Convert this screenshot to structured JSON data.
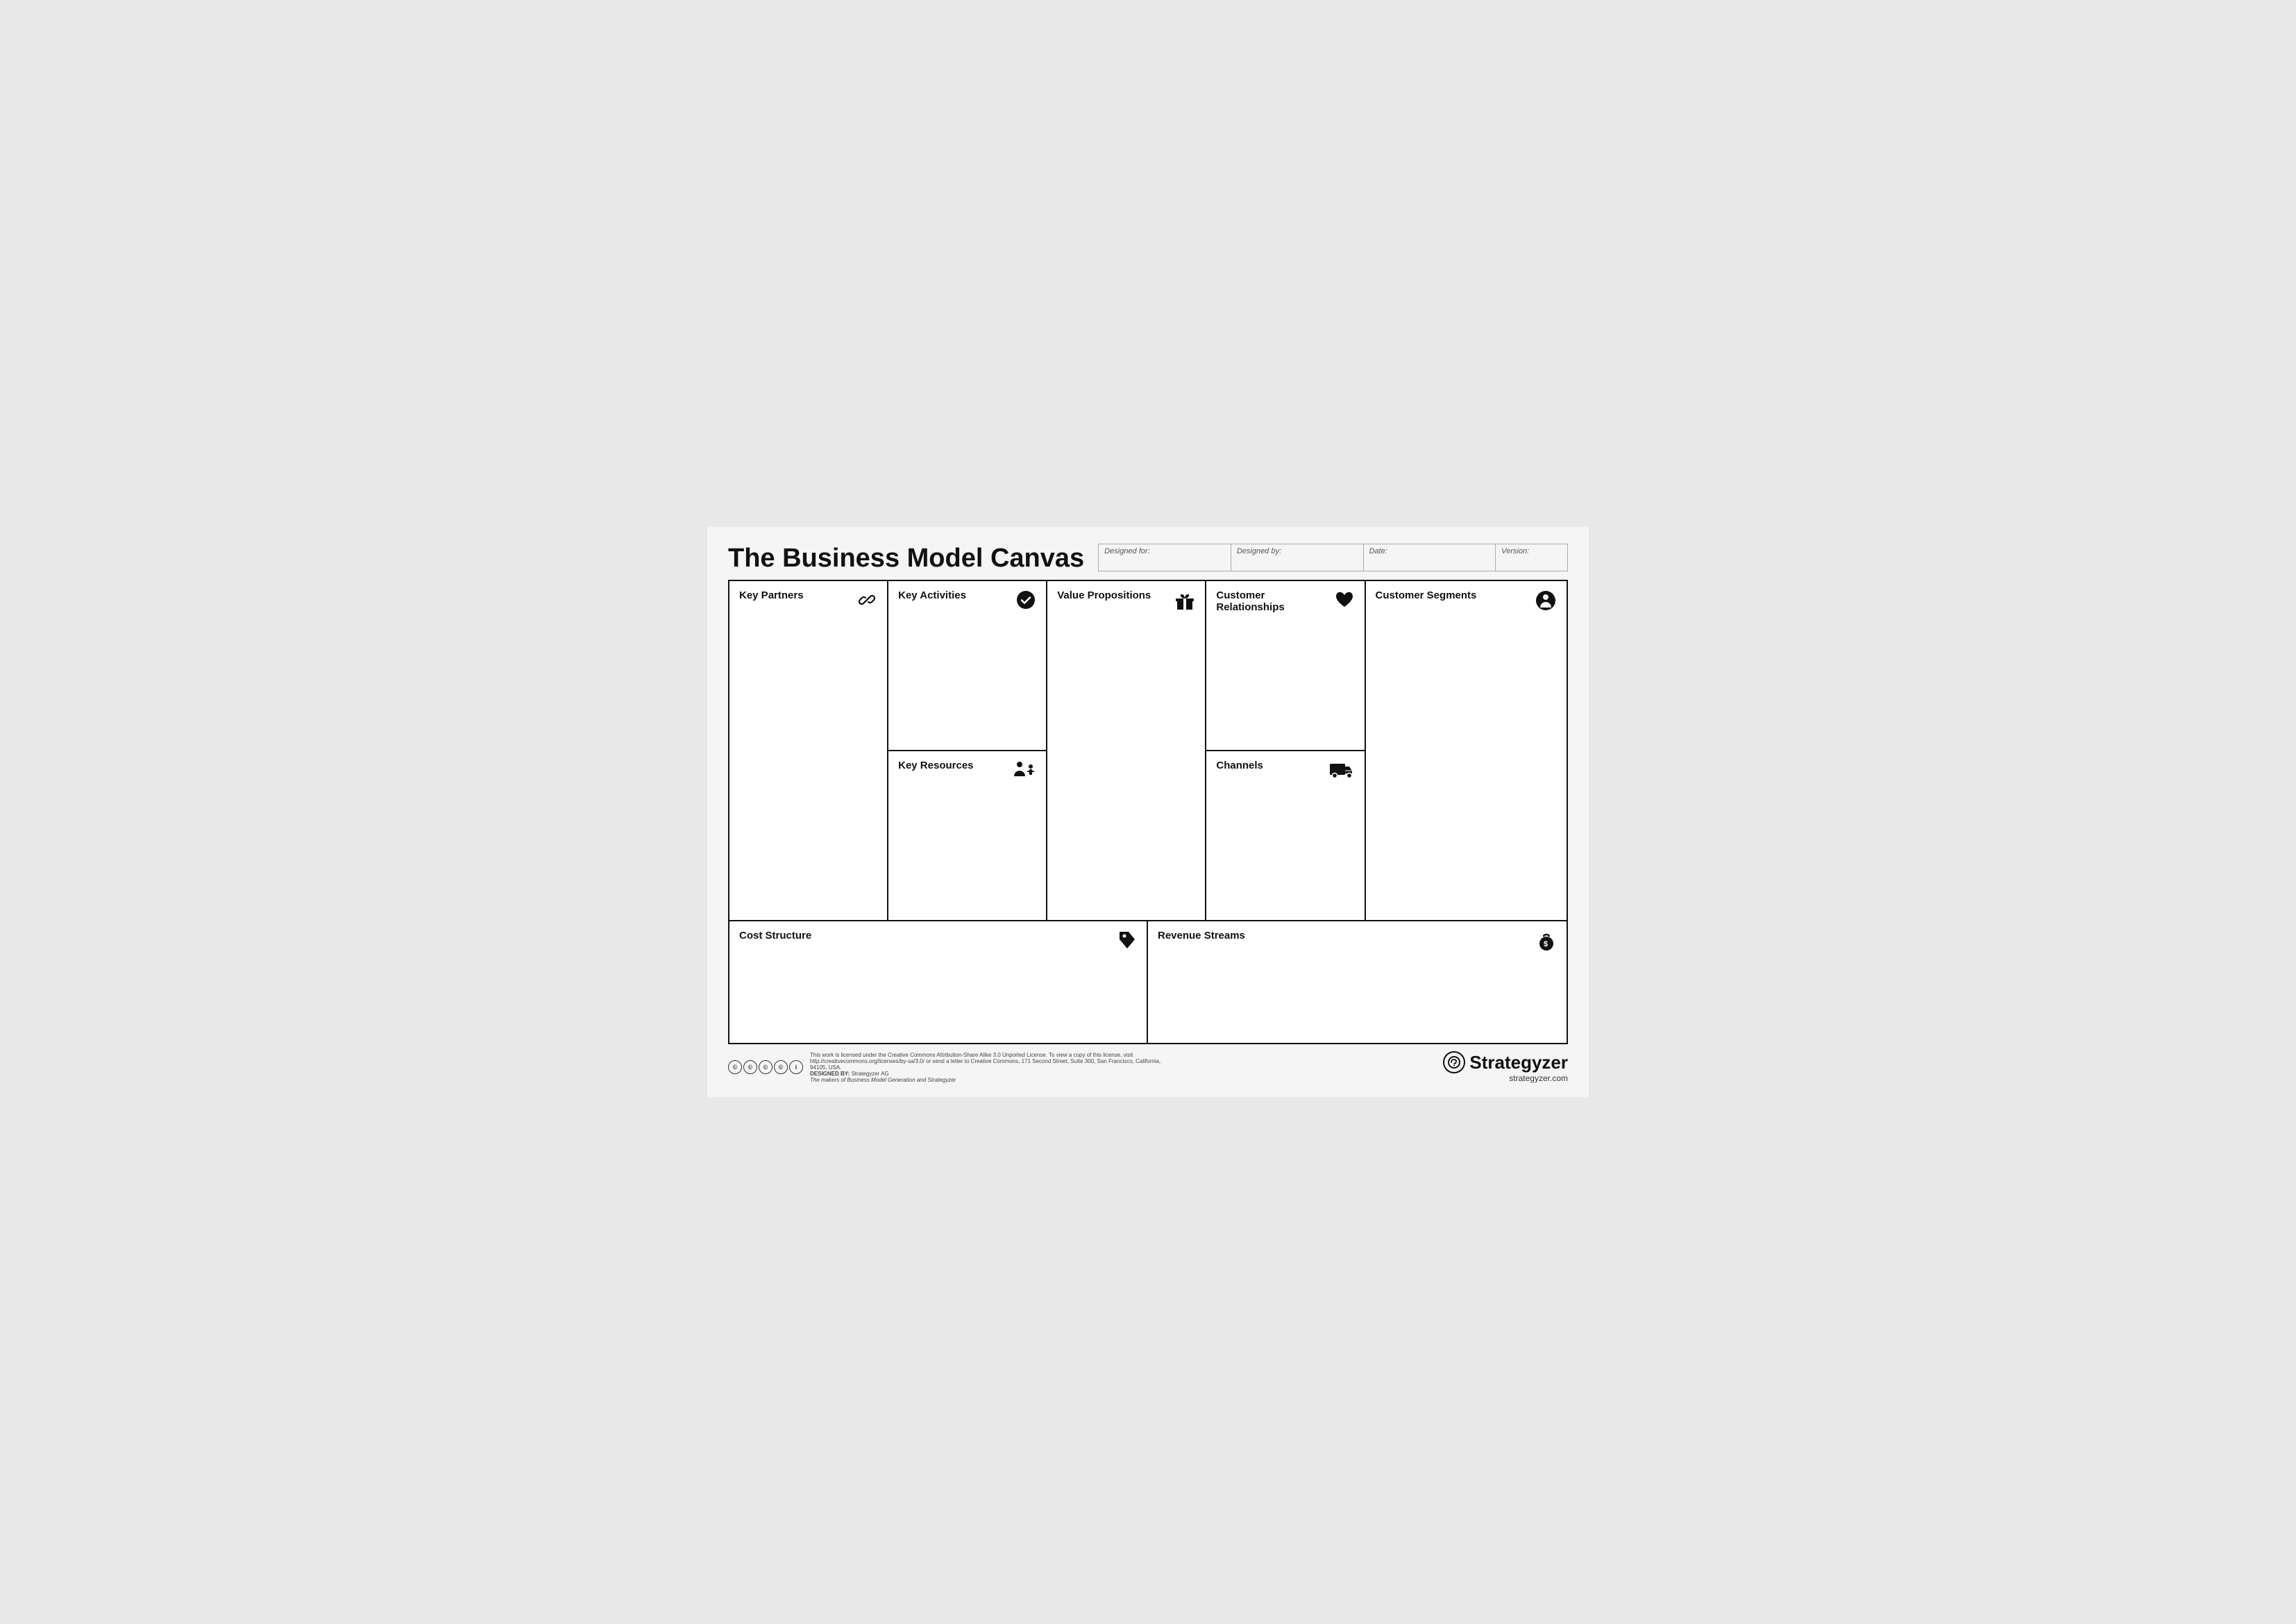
{
  "header": {
    "title": "The Business Model Canvas",
    "fields": [
      {
        "label": "Designed for:",
        "value": ""
      },
      {
        "label": "Designed by:",
        "value": ""
      },
      {
        "label": "Date:",
        "value": ""
      },
      {
        "label": "Version:",
        "value": ""
      }
    ]
  },
  "cells": {
    "key_partners": {
      "label": "Key Partners",
      "icon": "🔗"
    },
    "key_activities": {
      "label": "Key Activities",
      "icon": "✔"
    },
    "key_resources": {
      "label": "Key Resources",
      "icon": "👷"
    },
    "value_propositions": {
      "label": "Value Propositions",
      "icon": "🎁"
    },
    "customer_relationships": {
      "label": "Customer Relationships",
      "icon": "♥"
    },
    "channels": {
      "label": "Channels",
      "icon": "🚛"
    },
    "customer_segments": {
      "label": "Customer Segments",
      "icon": "👤"
    },
    "cost_structure": {
      "label": "Cost Structure",
      "icon": "🏷"
    },
    "revenue_streams": {
      "label": "Revenue Streams",
      "icon": "💰"
    }
  },
  "footer": {
    "designed_by_label": "DESIGNED BY:",
    "company": "Strategyzer AG",
    "tagline_prefix": "The makers of ",
    "tagline_italic": "Business Model Generation and Strategyzer",
    "license_text": "This work is licensed under the Creative Commons Attribution-Share Alike 3.0 Unported License. To view a copy of this license, visit",
    "license_url": "http://creativecommons.org/licenses/by-sa/3.0/ or send a letter to Creative Commons, 171 Second Street, Suite 300, San Francisco, California, 94105, USA.",
    "brand": "Strategyzer",
    "brand_url": "strategyzer.com"
  }
}
